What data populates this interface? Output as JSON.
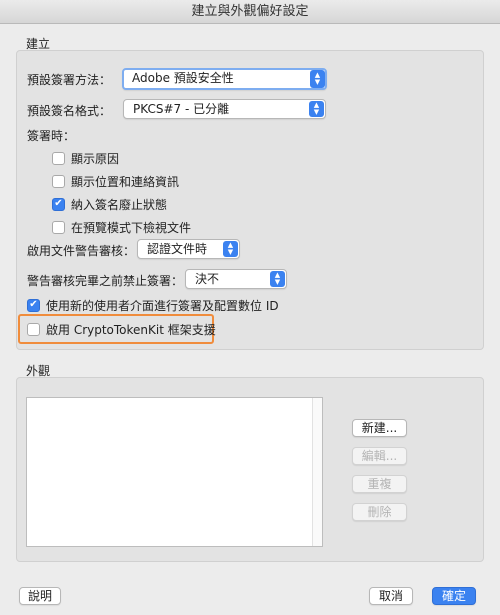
{
  "window": {
    "title": "建立與外觀偏好設定"
  },
  "create_section": {
    "title": "建立",
    "signing_method_label": "預設簽署方法：",
    "signing_method_value": "Adobe 預設安全性",
    "signing_format_label": "預設簽名格式：",
    "signing_format_value": "PKCS#7 - 已分離",
    "when_signing_label": "簽署時：",
    "options": [
      {
        "label": "顯示原因",
        "checked": false
      },
      {
        "label": "顯示位置和連絡資訊",
        "checked": false
      },
      {
        "label": "納入簽名廢止狀態",
        "checked": true
      },
      {
        "label": "在預覽模式下檢視文件",
        "checked": false
      }
    ],
    "warning_review_label": "啟用文件警告審核：",
    "warning_review_value": "認證文件時",
    "prevent_signing_label": "警告審核完畢之前禁止簽署：",
    "prevent_signing_value": "決不",
    "new_ui": {
      "label": "使用新的使用者介面進行簽署及配置數位 ID",
      "checked": true
    },
    "cryptotokenkit": {
      "label": "啟用 CryptoTokenKit 框架支援",
      "checked": false
    }
  },
  "appearance_section": {
    "title": "外觀",
    "buttons": {
      "new": "新建...",
      "edit": "編輯...",
      "duplicate": "重複",
      "delete": "刪除"
    }
  },
  "footer": {
    "help": "說明",
    "cancel": "取消",
    "ok": "確定"
  },
  "colors": {
    "accent": "#3b82f0",
    "highlight": "#f08c3c"
  }
}
